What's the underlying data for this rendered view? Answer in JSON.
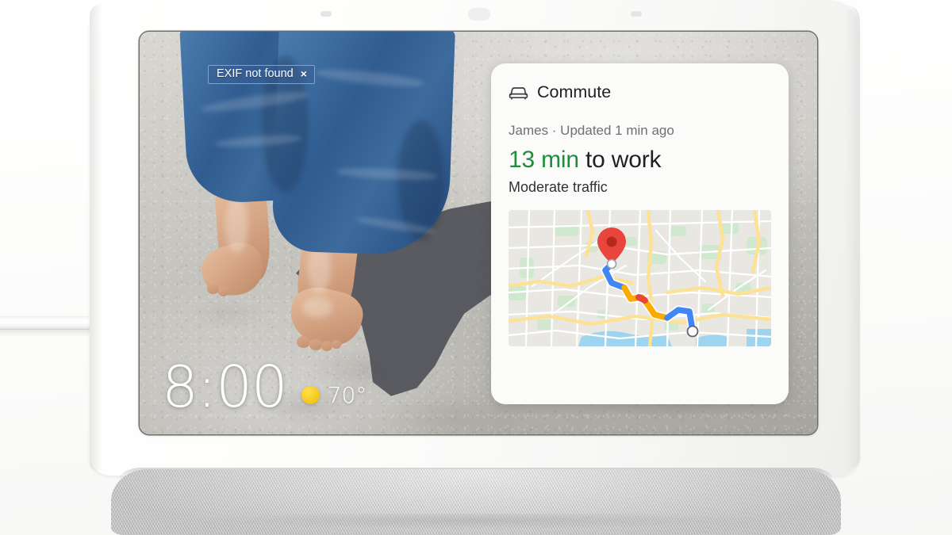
{
  "device": {
    "name": "smart-display",
    "sensors": [
      "ambient-light-sensor",
      "microphone",
      "proximity-sensor"
    ]
  },
  "photo": {
    "description": "child walking barefoot on sand wearing blue denim shorts",
    "exif_badge": {
      "label": "EXIF not found",
      "close_label": "×"
    }
  },
  "clock": {
    "time": "8:00",
    "weather_icon": "sun-icon",
    "temperature": "70°"
  },
  "commute_card": {
    "icon": "car-icon",
    "title": "Commute",
    "meta": "James · Updated 1 min ago",
    "eta_time": "13 min",
    "eta_suffix": " to work",
    "traffic": "Moderate traffic",
    "accent_green": "#1e8e3e",
    "map": {
      "origin_marker": "destination-pin",
      "destination_marker": "origin-circle",
      "traffic_segments": [
        {
          "color": "#4285f4",
          "label": "free-flowing"
        },
        {
          "color": "#f9ab00",
          "label": "slow"
        },
        {
          "color": "#e8453c",
          "label": "heavy"
        }
      ],
      "water_color": "#9fd4ef",
      "park_color": "#cfe8ce",
      "highway_color": "#fde293",
      "road_color": "#ffffff",
      "land_color": "#e9e7e2"
    }
  }
}
